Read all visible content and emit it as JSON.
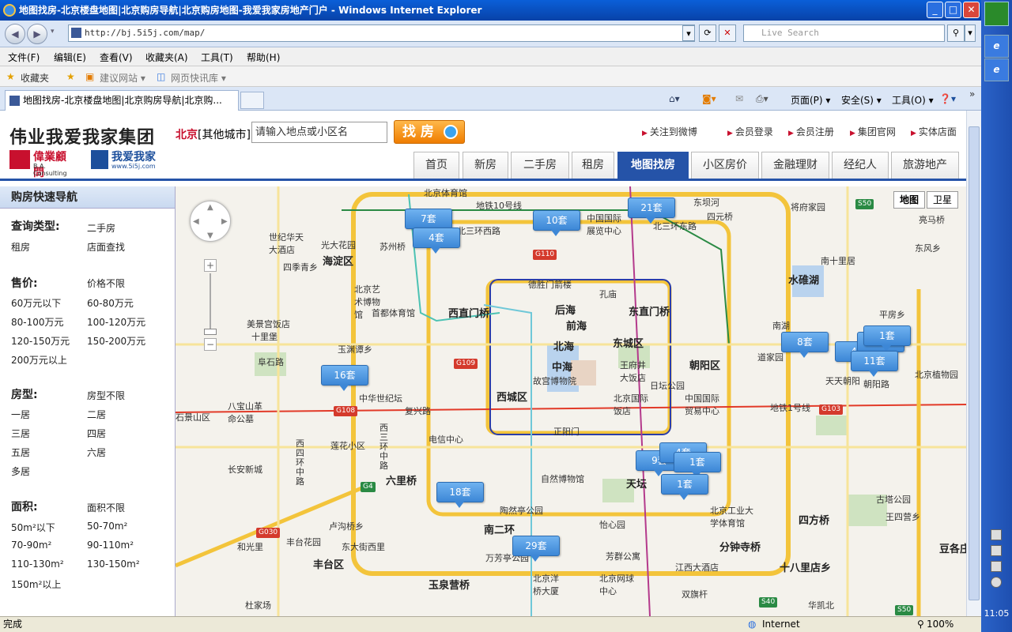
{
  "window": {
    "title": "地图找房-北京楼盘地图|北京购房导航|北京购房地图-我爱我家房地产门户 - Windows Internet Explorer",
    "min": "_",
    "max": "□",
    "close": "✕"
  },
  "browser": {
    "url": "http://bj.5i5j.com/map/",
    "search_placeholder": "Live Search",
    "menu": [
      "文件(F)",
      "编辑(E)",
      "查看(V)",
      "收藏夹(A)",
      "工具(T)",
      "帮助(H)"
    ],
    "favorites_label": "收藏夹",
    "fav_items": [
      "建议网站 ▾",
      "网页快讯库 ▾"
    ],
    "tab_title": "地图找房-北京楼盘地图|北京购房导航|北京购...",
    "commands": [
      "页面(P) ▾",
      "安全(S) ▾",
      "工具(O) ▾"
    ],
    "status_left": "完成",
    "status_zone": "Internet",
    "zoom": "100%",
    "clock": "11:05"
  },
  "site": {
    "brand": "伟业我爱我家集团",
    "ba_name": "偉業顧問",
    "ba_sub": "B.A. Consulting",
    "wawj_name": "我爱我家",
    "wawj_sub": "www.5i5j.com",
    "city": "北京",
    "city_other": "[其他城市]",
    "search_value": "请输入地点或小区名",
    "search_button": "找 房",
    "top_links": [
      "关注到微博",
      "会员登录",
      "会员注册",
      "集团官网",
      "实体店面"
    ],
    "nav": [
      "首页",
      "新房",
      "二手房",
      "租房",
      "地图找房",
      "小区房价",
      "金融理财",
      "经纪人",
      "旅游地产"
    ],
    "nav_active": "地图找房"
  },
  "filters": {
    "header": "购房快速导航",
    "type_label": "查询类型:",
    "types": [
      "二手房",
      "租房",
      "店面查找"
    ],
    "price_label": "售价:",
    "prices": [
      "价格不限",
      "60万元以下",
      "60-80万元",
      "80-100万元",
      "100-120万元",
      "120-150万元",
      "150-200万元",
      "200万元以上"
    ],
    "room_label": "房型:",
    "rooms": [
      "房型不限",
      "一居",
      "二居",
      "三居",
      "四居",
      "五居",
      "六居",
      "多居"
    ],
    "area_label": "面积:",
    "areas": [
      "面积不限",
      "50m²以下",
      "50-70m²",
      "70-90m²",
      "90-110m²",
      "110-130m²",
      "130-150m²",
      "150m²以上"
    ]
  },
  "map": {
    "type_buttons": [
      "地图",
      "卫星"
    ],
    "markers": [
      "7套",
      "4套",
      "10套",
      "21套",
      "8套",
      "4套",
      "3套",
      "1套",
      "11套",
      "16套",
      "9套",
      "4套",
      "1套",
      "1套",
      "18套",
      "29套"
    ],
    "labels": [
      "北京体育馆",
      "地铁10号线",
      "北三环西路",
      "北三环东路",
      "东坝河",
      "四元桥",
      "将府家园",
      "亮马桥",
      "苏州桥",
      "海淀区",
      "中国国际展览中心",
      "四季青乡",
      "世纪华天大酒店",
      "光大花园",
      "南十里居",
      "东风乡",
      "北京艺术博物馆",
      "首都体育馆",
      "西直门桥",
      "德胜门箭楼",
      "孔庙",
      "东直门桥",
      "水碓湖",
      "平房乡",
      "玉渊谭乡",
      "后海",
      "前海",
      "北海",
      "东城区",
      "南湖",
      "道家园",
      "天天朝阳",
      "朝阳路",
      "北京植物园",
      "美景宫饭店",
      "中海",
      "王府井大饭店",
      "朝阳区",
      "十里堡",
      "阜石路",
      "故宫博物院",
      "日坛公园",
      "中华世纪坛",
      "西城区",
      "北京国际饭店",
      "中国国际贸易中心",
      "八宝山革命公墓",
      "复兴路",
      "地铁1号线",
      "石景山区",
      "正阳门",
      "电信中心",
      "长安新城",
      "莲花小区",
      "西四环中路",
      "西三环中路",
      "六里桥",
      "自然博物馆",
      "天坛",
      "四方桥",
      "陶然亭公园",
      "北京工业大学体育馆",
      "王四营乡",
      "古塔公园",
      "南二环",
      "怡心园",
      "卢沟桥乡",
      "丰台花园",
      "东大街西里",
      "和光里",
      "分钟寺桥",
      "丰台区",
      "万芳亭公园",
      "芳群公寓",
      "北京洋桥大厦",
      "北京网球中心",
      "江西大酒店",
      "十八里店乡",
      "玉泉营桥",
      "双旗杆",
      "杜家场",
      "华凯北",
      "豆各庄"
    ],
    "shields": [
      "S50",
      "G110",
      "G109",
      "G108",
      "G103",
      "G4",
      "G030",
      "S40",
      "S50"
    ]
  }
}
